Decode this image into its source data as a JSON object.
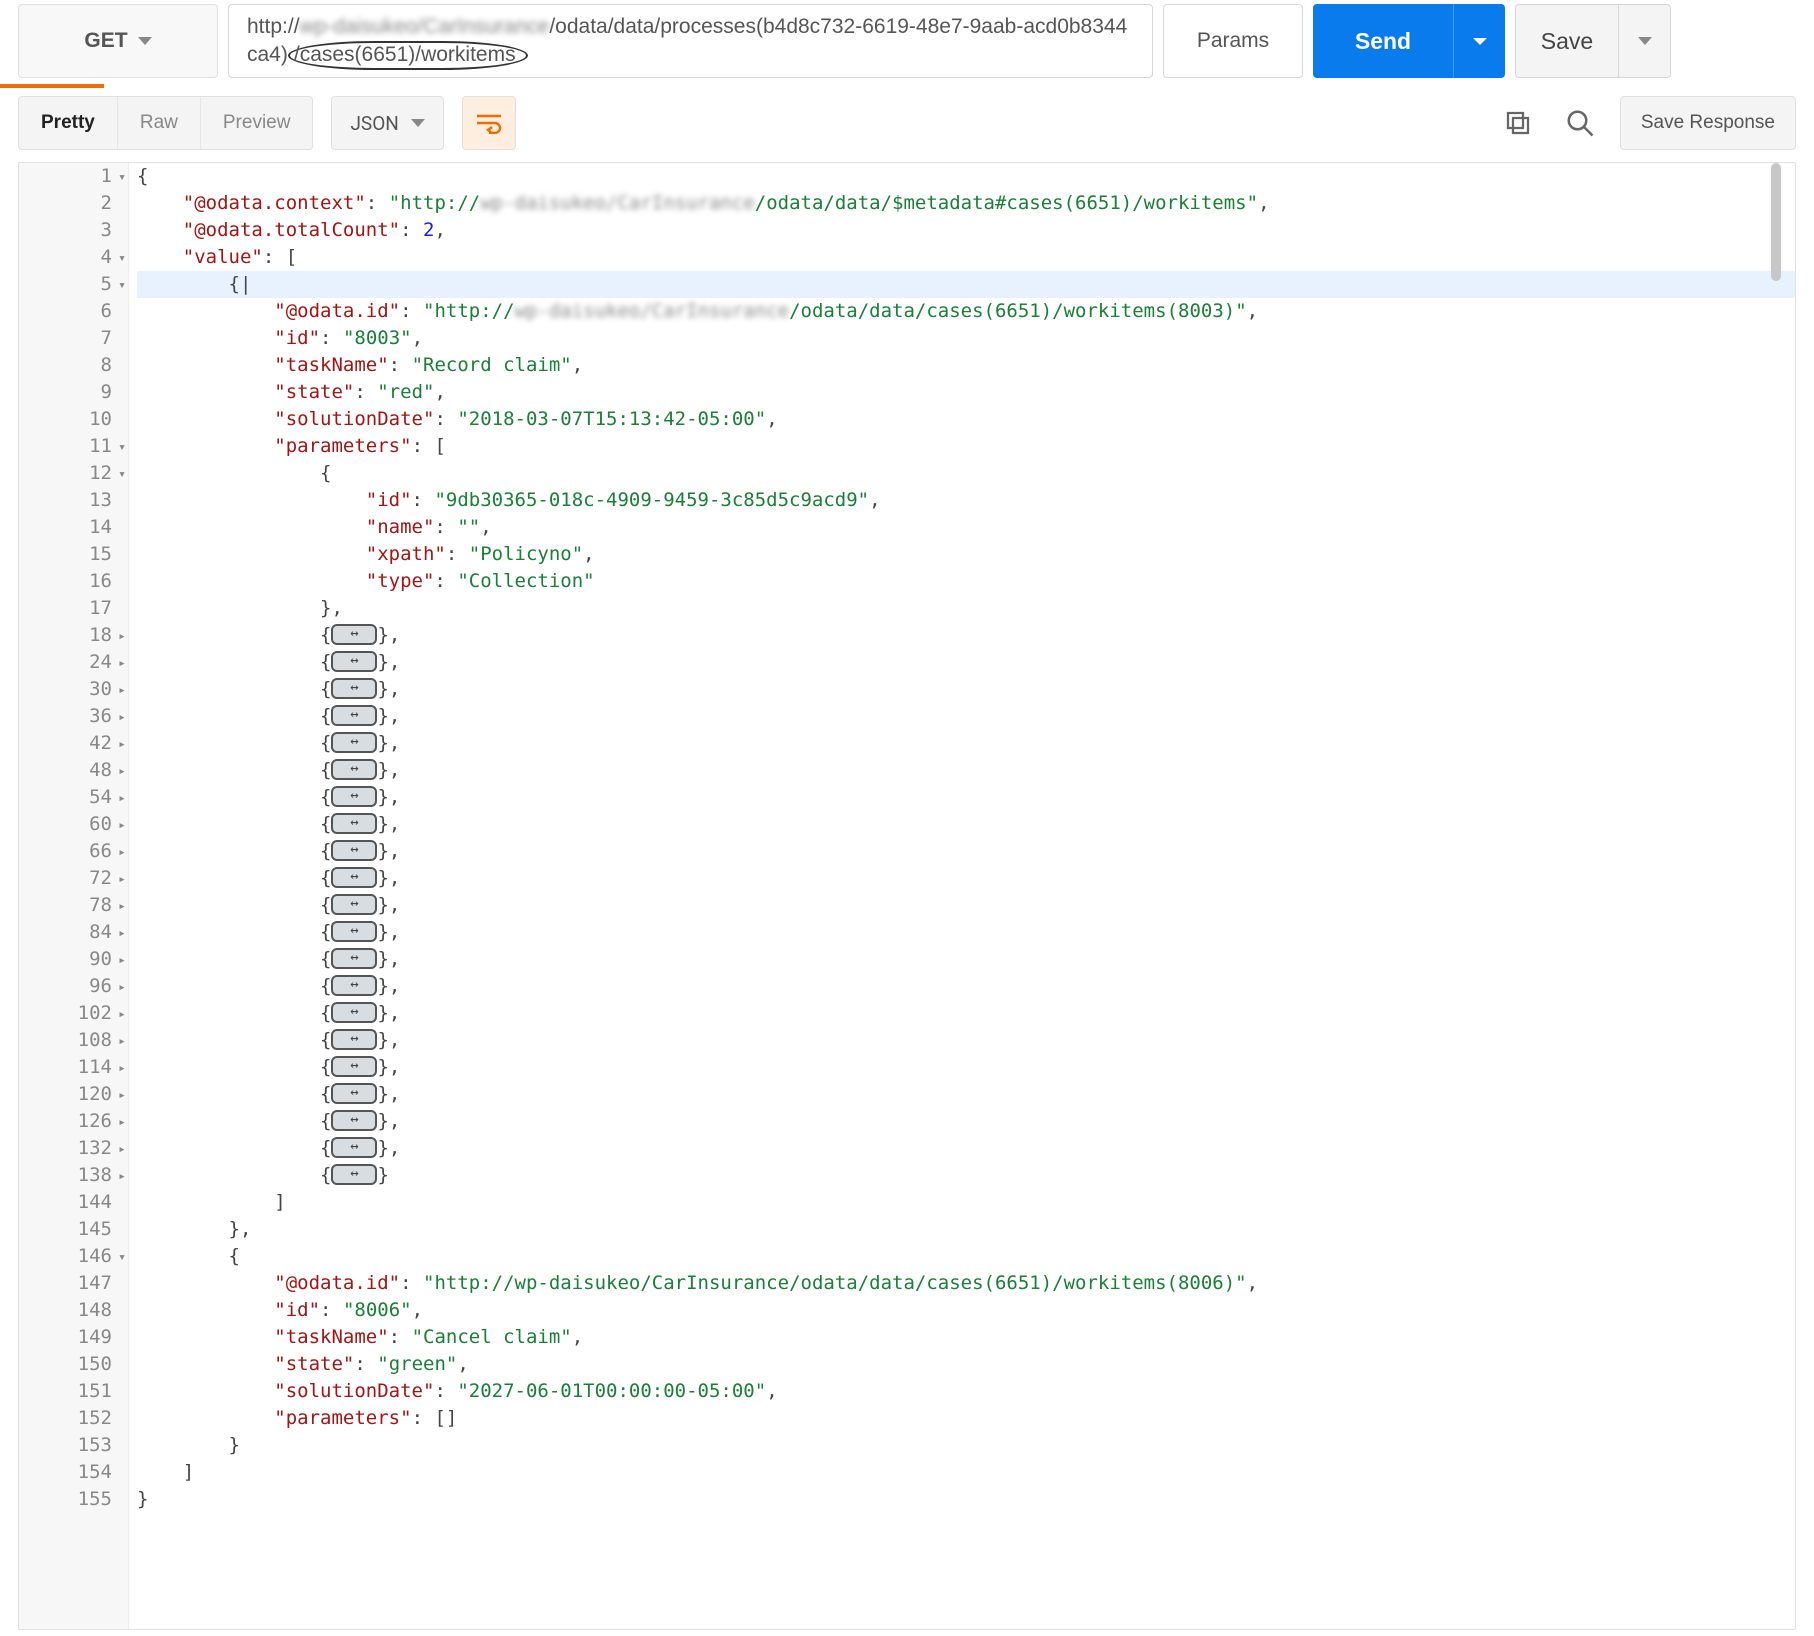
{
  "request": {
    "method": "GET",
    "url_prefix": "http://",
    "url_blurred": "wp-daisukeo/CarInsurance",
    "url_mid": "/odata/data/processes(b4d8c732-6619-48e7-9aab-acd0b8344ca4)",
    "url_circled": "/cases(6651)/workitems",
    "params_label": "Params",
    "send_label": "Send",
    "save_label": "Save"
  },
  "viewer": {
    "tabs": [
      "Pretty",
      "Raw",
      "Preview"
    ],
    "active_tab": "Pretty",
    "format": "JSON",
    "save_response_label": "Save Response"
  },
  "gutter_lines": [
    "1",
    "2",
    "3",
    "4",
    "5",
    "6",
    "7",
    "8",
    "9",
    "10",
    "11",
    "12",
    "13",
    "14",
    "15",
    "16",
    "17",
    "18",
    "24",
    "30",
    "36",
    "42",
    "48",
    "54",
    "60",
    "66",
    "72",
    "78",
    "84",
    "90",
    "96",
    "102",
    "108",
    "114",
    "120",
    "126",
    "132",
    "138",
    "144",
    "145",
    "146",
    "147",
    "148",
    "149",
    "150",
    "151",
    "152",
    "153",
    "154",
    "155"
  ],
  "gutter_fold_open": [
    "1",
    "4",
    "5",
    "11",
    "12",
    "146"
  ],
  "gutter_fold_closed": [
    "18",
    "24",
    "30",
    "36",
    "42",
    "48",
    "54",
    "60",
    "66",
    "72",
    "78",
    "84",
    "90",
    "96",
    "102",
    "108",
    "114",
    "120",
    "126",
    "132",
    "138"
  ],
  "response": {
    "odata_context_pre": "\"http://",
    "odata_context_blur": "wp-daisukeo/CarInsurance",
    "odata_context_post": "/odata/data/$metadata#cases(6651)/workitems\"",
    "total_count": "2",
    "item1": {
      "odata_id_pre": "\"http://",
      "odata_id_blur": "wp-daisukeo/CarInsurance",
      "odata_id_post": "/odata/data/cases(6651)/workitems(8003)\"",
      "id": "\"8003\"",
      "taskName": "\"Record claim\"",
      "state": "\"red\"",
      "solutionDate": "\"2018-03-07T15:13:42-05:00\"",
      "param1": {
        "id": "\"9db30365-018c-4909-9459-3c85d5c9acd9\"",
        "name": "\"\"",
        "xpath": "\"Policyno\"",
        "type": "\"Collection\""
      }
    },
    "item2": {
      "odata_id": "\"http://wp-daisukeo/CarInsurance/odata/data/cases(6651)/workitems(8006)\"",
      "id": "\"8006\"",
      "taskName": "\"Cancel claim\"",
      "state": "\"green\"",
      "solutionDate": "\"2027-06-01T00:00:00-05:00\""
    },
    "collapsed_count": 21
  }
}
